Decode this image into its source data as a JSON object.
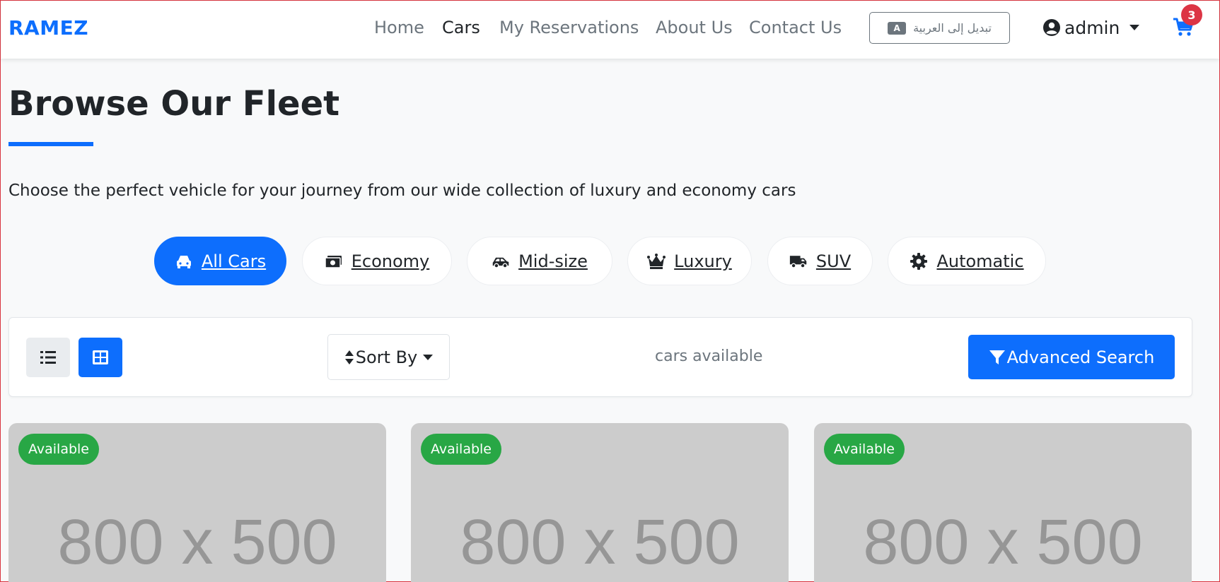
{
  "nav": {
    "brand": "RAMEZ",
    "links": [
      "Home",
      "Cars",
      "My Reservations",
      "About Us",
      "Contact Us"
    ],
    "active_link": "Cars",
    "lang_switch_label": "تبديل إلى العربية",
    "lang_icon_text": "A",
    "user_label": "admin",
    "cart_count": "3"
  },
  "hero": {
    "title": "Browse Our Fleet",
    "subtitle": "Choose the perfect vehicle for your journey from our wide collection of luxury and economy cars"
  },
  "filters": [
    {
      "label": "All Cars",
      "icon": "car-icon",
      "active": true
    },
    {
      "label": "Economy",
      "icon": "money-icon",
      "active": false
    },
    {
      "label": "Mid-size",
      "icon": "car-side-icon",
      "active": false
    },
    {
      "label": "Luxury",
      "icon": "crown-icon",
      "active": false
    },
    {
      "label": "SUV",
      "icon": "truck-icon",
      "active": false
    },
    {
      "label": "Automatic",
      "icon": "gear-icon",
      "active": false
    }
  ],
  "toolbar": {
    "sort_label": "Sort By",
    "count_text": "cars available",
    "advanced_search_label": "Advanced Search"
  },
  "cars": [
    {
      "status": "Available",
      "image_placeholder": "800 x 500"
    },
    {
      "status": "Available",
      "image_placeholder": "800 x 500"
    },
    {
      "status": "Available",
      "image_placeholder": "800 x 500"
    }
  ],
  "colors": {
    "primary": "#0d6efd",
    "success": "#28a745",
    "danger": "#dc3545",
    "muted": "#6c757d"
  }
}
